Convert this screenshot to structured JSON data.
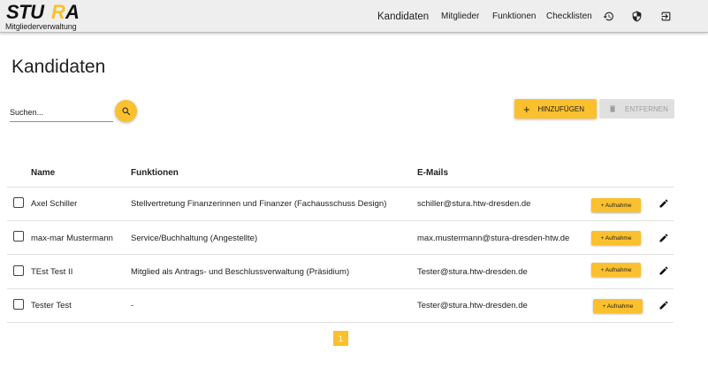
{
  "header": {
    "logo_text": "STURA",
    "logo_subtitle": "Mitgliederverwaltung",
    "nav": [
      {
        "label": "Kandidaten",
        "active": true
      },
      {
        "label": "Mitglieder",
        "active": false
      },
      {
        "label": "Funktionen",
        "active": false
      },
      {
        "label": "Checklisten",
        "active": false
      }
    ],
    "icons": [
      "history-icon",
      "shield-icon",
      "logout-icon"
    ]
  },
  "page": {
    "title": "Kandidaten"
  },
  "search": {
    "placeholder": "Suchen...",
    "value": ""
  },
  "actions": {
    "add_label": "HINZUFÜGEN",
    "add_icon": "plus-icon",
    "remove_label": "ENTFERNEN",
    "remove_icon": "delete-icon"
  },
  "table": {
    "columns": [
      "Name",
      "Funktionen",
      "E-Mails"
    ],
    "row_action_label": "+ Aufnahme",
    "rows": [
      {
        "name": "Axel Schiller",
        "funktion": "Stellvertretung Finanzerinnen und Finanzer (Fachausschuss Design)",
        "email": "schiller@stura.htw-dresden.de",
        "checked": false
      },
      {
        "name": "max-mar Mustermann",
        "funktion": "Service/Buchhaltung (Angestellte)",
        "email": "max.mustermann@stura-dresden-htw.de",
        "checked": false
      },
      {
        "name": "TEst Test II",
        "funktion": "Mitglied als Antrags- und Beschlussverwaltung (Präsidium)",
        "email": "Tester@stura.htw-dresden.de",
        "checked": false
      },
      {
        "name": "Tester Test",
        "funktion": "-",
        "email": "Tester@stura.htw-dresden.de",
        "checked": false
      }
    ]
  },
  "pagination": {
    "current_page": "1"
  },
  "colors": {
    "accent": "#fbc02d",
    "topbar": "#eeeeee",
    "text": "#212121",
    "disabled": "#e0e0e0"
  }
}
